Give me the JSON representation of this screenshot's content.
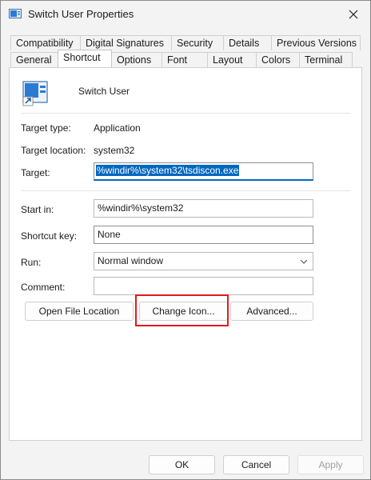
{
  "window": {
    "title": "Switch User Properties",
    "close_icon": "close-icon"
  },
  "tabs": {
    "row1": [
      "Compatibility",
      "Digital Signatures",
      "Security",
      "Details",
      "Previous Versions"
    ],
    "row2": [
      "General",
      "Shortcut",
      "Options",
      "Font",
      "Layout",
      "Colors",
      "Terminal"
    ],
    "active": "Shortcut"
  },
  "shortcut": {
    "name": "Switch User",
    "target_type_label": "Target type:",
    "target_type_value": "Application",
    "target_location_label": "Target location:",
    "target_location_value": "system32",
    "target_label": "Target:",
    "target_value": "%windir%\\system32\\tsdiscon.exe",
    "start_in_label": "Start in:",
    "start_in_value": "%windir%\\system32",
    "shortcut_key_label": "Shortcut key:",
    "shortcut_key_value": "None",
    "run_label": "Run:",
    "run_value": "Normal window",
    "comment_label": "Comment:",
    "comment_value": ""
  },
  "buttons": {
    "open_file_location": "Open File Location",
    "change_icon": "Change Icon...",
    "advanced": "Advanced...",
    "ok": "OK",
    "cancel": "Cancel",
    "apply": "Apply"
  },
  "colors": {
    "highlight_box": "#e01b1b",
    "selection": "#0067c0"
  }
}
